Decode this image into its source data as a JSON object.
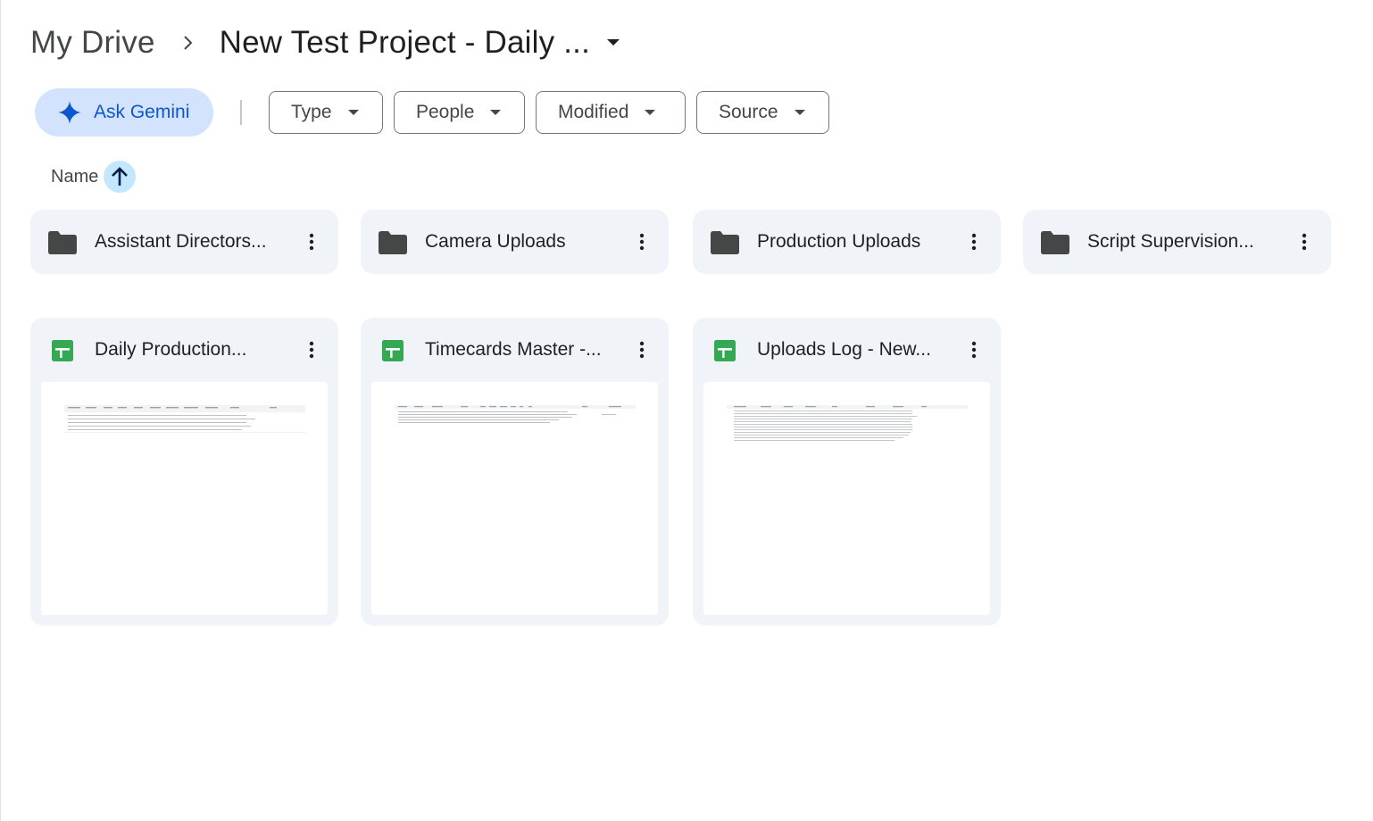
{
  "breadcrumb": {
    "root": "My Drive",
    "current": "New Test Project - Daily ..."
  },
  "filters": {
    "gemini_label": "Ask Gemini",
    "chips": [
      "Type",
      "People",
      "Modified",
      "Source"
    ]
  },
  "sort": {
    "label": "Name",
    "direction": "ascending"
  },
  "folders": [
    {
      "name": "Assistant Directors..."
    },
    {
      "name": "Camera Uploads"
    },
    {
      "name": "Production Uploads"
    },
    {
      "name": "Script Supervision..."
    }
  ],
  "files": [
    {
      "name": "Daily Production...",
      "icon": "google-sheets-icon"
    },
    {
      "name": "Timecards Master -...",
      "icon": "google-sheets-icon"
    },
    {
      "name": "Uploads Log - New...",
      "icon": "google-sheets-icon"
    }
  ],
  "colors": {
    "accent": "#0b57d0",
    "gemini_bg": "#d3e3fd",
    "sort_bg": "#c2e7ff",
    "card_bg": "#f0f4f9",
    "sheets_green": "#34a853"
  }
}
